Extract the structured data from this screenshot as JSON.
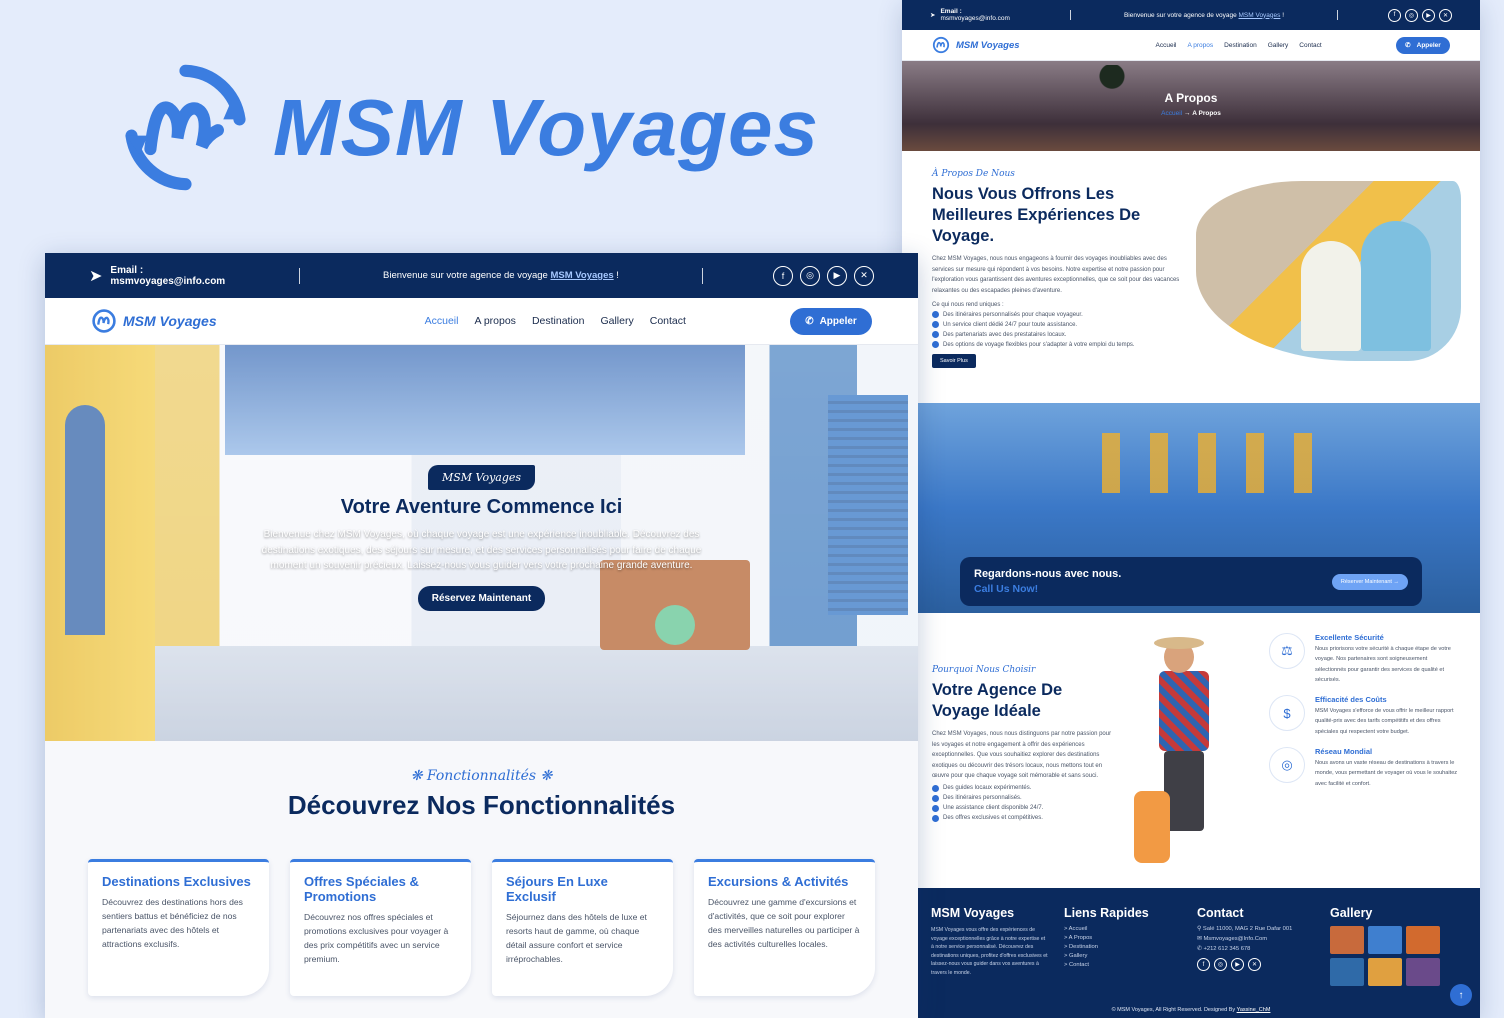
{
  "brand": {
    "name": "MSM Voyages",
    "accent": "#3b7de0",
    "navy": "#0b2a5e"
  },
  "front": {
    "topbar": {
      "email_label": "Email :",
      "email_value": "msmvoyages@info.com",
      "welcome_prefix": "Bienvenue sur votre agence de voyage",
      "welcome_link": "MSM Voyages",
      "welcome_suffix": "!"
    },
    "nav": {
      "logo": "MSM Voyages",
      "items": [
        "Accueil",
        "A propos",
        "Destination",
        "Gallery",
        "Contact"
      ],
      "active": "Accueil",
      "call": "Appeler"
    },
    "hero": {
      "badge": "MSM Voyages",
      "title": "Votre Aventure Commence Ici",
      "text": "Bienvenue chez MSM Voyages, où chaque voyage est une expérience inoubliable. Découvrez des destinations exotiques, des séjours sur mesure, et des services personnalisés pour faire de chaque moment un souvenir précieux. Laissez-nous vous guider vers votre prochaine grande aventure.",
      "cta": "Réservez Maintenant"
    },
    "features": {
      "tag": "Fonctionnalités",
      "title": "Découvrez Nos Fonctionnalités",
      "cards": [
        {
          "title": "Destinations Exclusives",
          "text": "Découvrez des destinations hors des sentiers battus et bénéficiez de nos partenariats avec des hôtels et attractions exclusifs."
        },
        {
          "title": "Offres Spéciales & Promotions",
          "text": "Découvrez nos offres spéciales et promotions exclusives pour voyager à des prix compétitifs avec un service premium."
        },
        {
          "title": "Séjours En Luxe Exclusif",
          "text": "Séjournez dans des hôtels de luxe et resorts haut de gamme, où chaque détail assure confort et service irréprochables."
        },
        {
          "title": "Excursions & Activités",
          "text": "Découvrez une gamme d'excursions et d'activités, que ce soit pour explorer des merveilles naturelles ou participer à des activités culturelles locales."
        }
      ]
    }
  },
  "back": {
    "topbar": {
      "email_label": "Email :",
      "email_value": "msmvoyages@info.com",
      "welcome_prefix": "Bienvenue sur votre agence de voyage",
      "welcome_link": "MSM Voyages",
      "welcome_suffix": "!"
    },
    "nav": {
      "logo": "MSM Voyages",
      "items": [
        "Accueil",
        "A propos",
        "Destination",
        "Gallery",
        "Contact"
      ],
      "active": "A propos",
      "call": "Appeler"
    },
    "banner": {
      "title": "A Propos",
      "crumb_home": "Accueil",
      "crumb_current": "A Propos"
    },
    "about": {
      "tag": "À Propos De Nous",
      "title": "Nous Vous Offrons Les Meilleures Expériences De Voyage.",
      "text": "Chez MSM Voyages, nous nous engageons à fournir des voyages inoubliables avec des services sur mesure qui répondent à vos besoins. Notre expertise et notre passion pour l'exploration vous garantissent des aventures exceptionnelles, que ce soit pour des vacances relaxantes ou des escapades pleines d'aventure.",
      "sub": "Ce qui nous rend uniques :",
      "checks": [
        "Des itinéraires personnalisés pour chaque voyageur.",
        "Un service client dédié 24/7 pour toute assistance.",
        "Des partenariats avec des prestataires locaux.",
        "Des options de voyage flexibles pour s'adapter à votre emploi du temps."
      ],
      "button": "Savoir Plus"
    },
    "cta": {
      "line1": "Regardons-nous avec nous.",
      "line2": "Call Us Now!",
      "button": "Réserver Maintenant →"
    },
    "why": {
      "tag": "Pourquoi Nous Choisir",
      "title": "Votre Agence De Voyage Idéale",
      "text": "Chez MSM Voyages, nous nous distinguons par notre passion pour les voyages et notre engagement à offrir des expériences exceptionnelles. Que vous souhaitiez explorer des destinations exotiques ou découvrir des trésors locaux, nous mettons tout en œuvre pour que chaque voyage soit mémorable et sans souci.",
      "checks": [
        "Des guides locaux expérimentés.",
        "Des itinéraires personnalisés.",
        "Une assistance client disponible 24/7.",
        "Des offres exclusives et compétitives."
      ],
      "items": [
        {
          "title": "Excellente Sécurité",
          "text": "Nous priorisons votre sécurité à chaque étape de votre voyage. Nos partenaires sont soigneusement sélectionnés pour garantir des services de qualité et sécurisés.",
          "icon": "⚖"
        },
        {
          "title": "Efficacité des Coûts",
          "text": "MSM Voyages s'efforce de vous offrir le meilleur rapport qualité-prix avec des tarifs compétitifs et des offres spéciales qui respectent votre budget.",
          "icon": "$"
        },
        {
          "title": "Réseau Mondial",
          "text": "Nous avons un vaste réseau de destinations à travers le monde, vous permettant de voyager où vous le souhaitez avec facilité et confort.",
          "icon": "◎"
        }
      ]
    },
    "footer": {
      "col1_title": "MSM Voyages",
      "col1_text": "MSM Voyages vous offre des expériences de voyage exceptionnelles grâce à notre expertise et à notre service personnalisé. Découvrez des destinations uniques, profitez d'offres exclusives et laissez-nous vous guider dans vos aventures à travers le monde.",
      "col2_title": "Liens Rapides",
      "links": [
        "> Accueil",
        "> A Propos",
        "> Destination",
        "> Gallery",
        "> Contact"
      ],
      "col3_title": "Contact",
      "address": "Salé 11000, MAG 2 Rue Dafar 001",
      "email": "Msmvoyages@Info.Com",
      "phone": "+212 612 345 678",
      "col4_title": "Gallery",
      "copyright_prefix": "© MSM Voyages, All Right Reserved. Designed By",
      "designer": "Yassine_ChM"
    }
  }
}
